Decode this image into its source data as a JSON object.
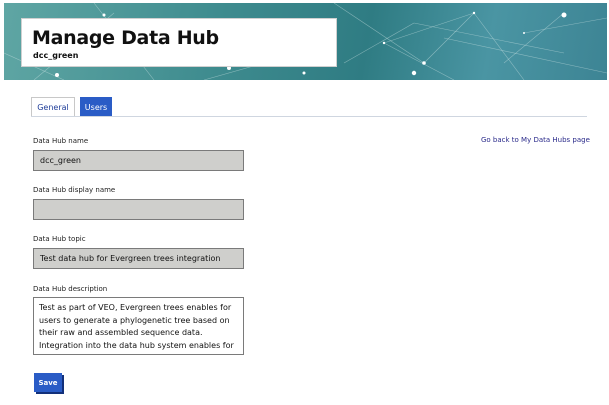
{
  "header": {
    "title": "Manage Data Hub",
    "subtitle": "dcc_green"
  },
  "tabs": [
    {
      "label": "General",
      "active": true
    },
    {
      "label": "Users",
      "active": false
    }
  ],
  "back_link": "Go back to My Data Hubs page",
  "form": {
    "name_label": "Data Hub name",
    "name_value": "dcc_green",
    "display_name_label": "Data Hub display name",
    "display_name_value": "",
    "topic_label": "Data Hub topic",
    "topic_value": "Test data hub for Evergreen trees integration",
    "description_label": "Data Hub description",
    "description_value": "Test as part of VEO, Evergreen trees enables for users to generate a phylogenetic tree based on their raw and assembled sequence data. Integration into the data hub system enables for systematic and automated processing of data held in a data hub."
  },
  "save_label": "Save",
  "colors": {
    "accent": "#2a5cc6",
    "banner": "#3f8c8f",
    "field_bg": "#cfcfcc"
  }
}
